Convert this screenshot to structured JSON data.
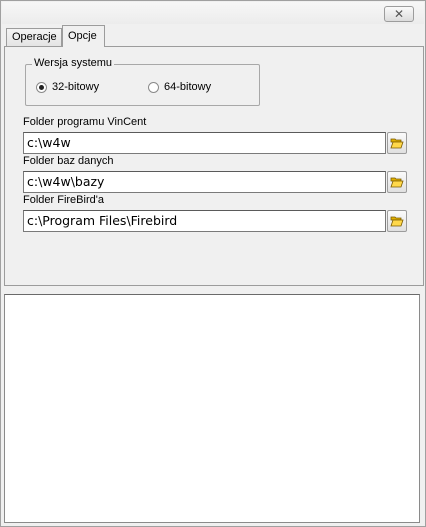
{
  "window": {
    "close_glyph": "✕"
  },
  "tabs": [
    {
      "label": "Operacje",
      "active": false
    },
    {
      "label": "Opcje",
      "active": true
    }
  ],
  "system_version": {
    "title": "Wersja systemu",
    "options": [
      {
        "label": "32-bitowy",
        "selected": true
      },
      {
        "label": "64-bitowy",
        "selected": false
      }
    ]
  },
  "fields": [
    {
      "label": "Folder programu VinCent",
      "value": "c:\\w4w",
      "button_icon": "open-folder-icon"
    },
    {
      "label": "Folder baz danych",
      "value": "c:\\w4w\\bazy",
      "button_icon": "open-folder-icon"
    },
    {
      "label": "Folder FireBird'a",
      "value": "c:\\Program Files\\Firebird",
      "button_icon": "open-folder-icon"
    }
  ],
  "log": {
    "text": ""
  }
}
